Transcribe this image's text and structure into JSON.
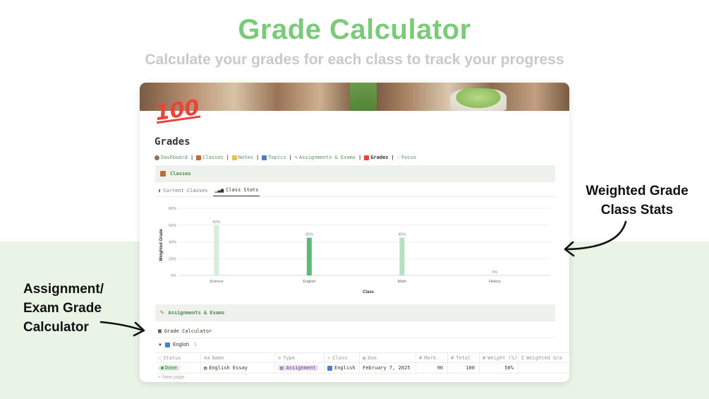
{
  "hero": {
    "title": "Grade Calculator",
    "subtitle": "Calculate your grades for each class to track your progress"
  },
  "page": {
    "title": "Grades",
    "icon": "hundred-points-emoji",
    "icon_text": "100"
  },
  "nav": {
    "items": [
      {
        "label": "Dashboard",
        "icon": "dashboard-icon"
      },
      {
        "label": "Classes",
        "icon": "books-icon"
      },
      {
        "label": "Notes",
        "icon": "folder-icon"
      },
      {
        "label": "Topics",
        "icon": "book-icon"
      },
      {
        "label": "Assignments & Exams",
        "icon": "pencil-icon"
      },
      {
        "label": "Grades",
        "icon": "hundred-icon"
      },
      {
        "label": "Focus",
        "icon": "timer-icon"
      }
    ],
    "separator": "|"
  },
  "classes_callout": {
    "label": "Classes"
  },
  "tabs": [
    {
      "label": "Current Classes"
    },
    {
      "label": "Class Stats"
    }
  ],
  "chart_data": {
    "type": "bar",
    "categories": [
      "Science",
      "English",
      "Math",
      "History"
    ],
    "values": [
      60,
      45,
      45,
      0
    ],
    "data_labels": [
      "60%",
      "45%",
      "45%",
      "0%"
    ],
    "colors": [
      "#d3eedb",
      "#5cb97a",
      "#b5e0c2",
      "#d3eedb"
    ],
    "xlabel": "Class",
    "ylabel": "Weighted Grade",
    "y_ticks": [
      "0%",
      "20%",
      "40%",
      "60%",
      "80%"
    ],
    "ylim": [
      0,
      80
    ],
    "grid": true
  },
  "assign_callout": {
    "label": "Assignments & Exams"
  },
  "database": {
    "title": "Grade Calculator",
    "group": {
      "label": "English",
      "count": "1"
    },
    "columns": [
      "Status",
      "Name",
      "Type",
      "Class",
      "Due",
      "Mark",
      "Total",
      "Weight (%)",
      "Weighted Gra"
    ],
    "rows": [
      {
        "status": "Done",
        "name": "English Essay",
        "type": "Assignment",
        "class": "English",
        "due": "February 7, 2025",
        "mark": "90",
        "total": "100",
        "weight": "50%"
      }
    ],
    "new_page": "New page"
  },
  "annotations": {
    "right_line1": "Weighted Grade",
    "right_line2": "Class Stats",
    "left_line1": "Assignment/",
    "left_line2": "Exam Grade",
    "left_line3": "Calculator"
  },
  "colors": {
    "accent_green": "#7acb78",
    "bg_green": "#e9f4e6",
    "callout_bg": "#edf3ec"
  }
}
